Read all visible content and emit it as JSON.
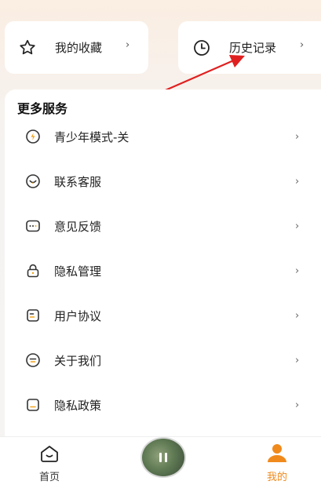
{
  "top_cards": {
    "favorites": {
      "label": "我的收藏",
      "icon": "star-icon",
      "chevron": "›"
    },
    "history": {
      "label": "历史记录",
      "icon": "clock-icon",
      "chevron": "›"
    }
  },
  "services": {
    "title": "更多服务",
    "items": [
      {
        "label": "青少年模式-关",
        "icon": "teen-mode-icon",
        "chevron": "›"
      },
      {
        "label": "联系客服",
        "icon": "customer-service-icon",
        "chevron": "›"
      },
      {
        "label": "意见反馈",
        "icon": "feedback-icon",
        "chevron": "›"
      },
      {
        "label": "隐私管理",
        "icon": "lock-icon",
        "chevron": "›"
      },
      {
        "label": "用户协议",
        "icon": "agreement-icon",
        "chevron": "›"
      },
      {
        "label": "关于我们",
        "icon": "about-icon",
        "chevron": "›"
      },
      {
        "label": "隐私政策",
        "icon": "privacy-policy-icon",
        "chevron": "›"
      }
    ]
  },
  "tabbar": {
    "home": {
      "label": "首页",
      "icon": "home-icon"
    },
    "mine": {
      "label": "我的",
      "icon": "person-icon"
    },
    "player": {
      "icon": "pause-icon"
    }
  },
  "colors": {
    "accent": "#f08a1c",
    "annotation_arrow": "#e02020",
    "chevron": "#666666"
  }
}
